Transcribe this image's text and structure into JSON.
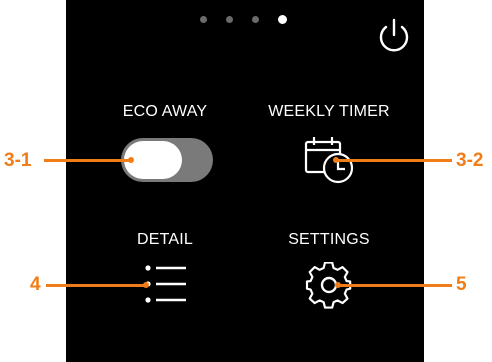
{
  "pagination": {
    "total": 4,
    "active_index": 3
  },
  "header": {
    "power_icon": "power-icon"
  },
  "tiles": {
    "eco_away": {
      "label": "ECO AWAY",
      "control": "toggle",
      "toggle_state": "on"
    },
    "weekly_timer": {
      "label": "WEEKLY TIMER",
      "icon": "calendar-clock-icon"
    },
    "detail": {
      "label": "DETAIL",
      "icon": "list-icon"
    },
    "settings": {
      "label": "SETTINGS",
      "icon": "gear-icon"
    }
  },
  "callouts": {
    "eco_away": "3-1",
    "weekly_timer": "3-2",
    "detail": "4",
    "settings": "5"
  },
  "colors": {
    "screen_bg": "#000000",
    "accent": "#f07d18",
    "toggle_track": "#7a7a7a",
    "foreground": "#ffffff"
  }
}
